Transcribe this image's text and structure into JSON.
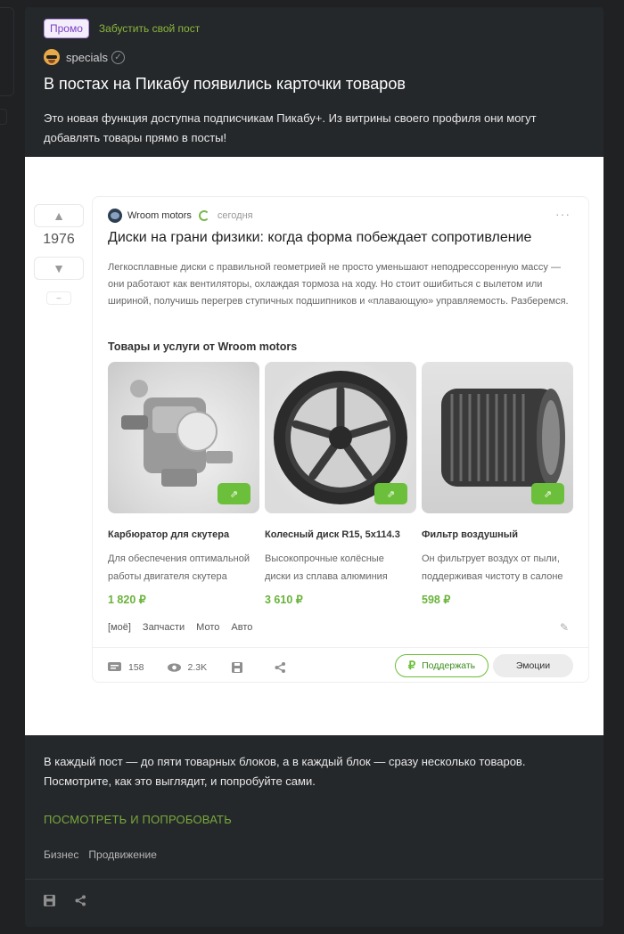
{
  "post": {
    "promo_badge": "Промо",
    "boost_link": "Забустить свой пост",
    "author": "specials",
    "title": "В постах на Пикабу появились карточки товаров",
    "intro": "Это новая функция доступна подписчикам Пикабу+. Из витрины своего профиля они могут добавлять товары прямо в посты!",
    "bottom_text": "В каждый пост — до пяти товарных блоков, а в каждый блок — сразу несколько товаров. Посмотрите, как это выглядит, и попробуйте сами.",
    "cta": "ПОСМОТРЕТЬ И ПОПРОБОВАТЬ",
    "tags": [
      "Бизнес",
      "Продвижение"
    ],
    "icons": [
      "save-icon",
      "share-icon"
    ]
  },
  "screenshot": {
    "rating": "1976",
    "minus": "–",
    "card": {
      "author": "Wroom motors",
      "time": "сегодня",
      "more": "···",
      "title": "Диски на грани физики: когда форма побеждает сопротивление",
      "description": "Легкосплавные диски с правильной геометрией не просто уменьшают неподрессоренную массу — они работают как вентиляторы, охлаждая тормоза на ходу. Но стоит ошибиться с вылетом или шириной, получишь перегрев ступичных подшипников и «плавающую» управляемость. Разберемся.",
      "goods_title": "Товары и услуги от Wroom motors",
      "products": [
        {
          "name": "Карбюратор для скутера",
          "desc1": "Для обеспечения оптимальной",
          "desc2": "работы двигателя скутера",
          "price": "1 820 ₽"
        },
        {
          "name": "Колесный диск R15, 5x114.3",
          "desc1": "Высокопрочные колёсные",
          "desc2": "диски из сплава алюминия",
          "price": "3 610 ₽"
        },
        {
          "name": "Фильтр воздушный",
          "desc1": "Он фильтрует воздух от пыли,",
          "desc2": "поддерживая чистоту в салоне",
          "price": "598 ₽"
        }
      ],
      "tags": [
        "[моё]",
        "Запчасти",
        "Мото",
        "Авто"
      ],
      "comments": "158",
      "views": "2.3K",
      "support": "Поддержать",
      "emotions": "Эмоции"
    }
  },
  "colors": {
    "accent_green": "#6cbf3a",
    "promo_purple": "#7a3fc7",
    "background": "#1f2123"
  }
}
